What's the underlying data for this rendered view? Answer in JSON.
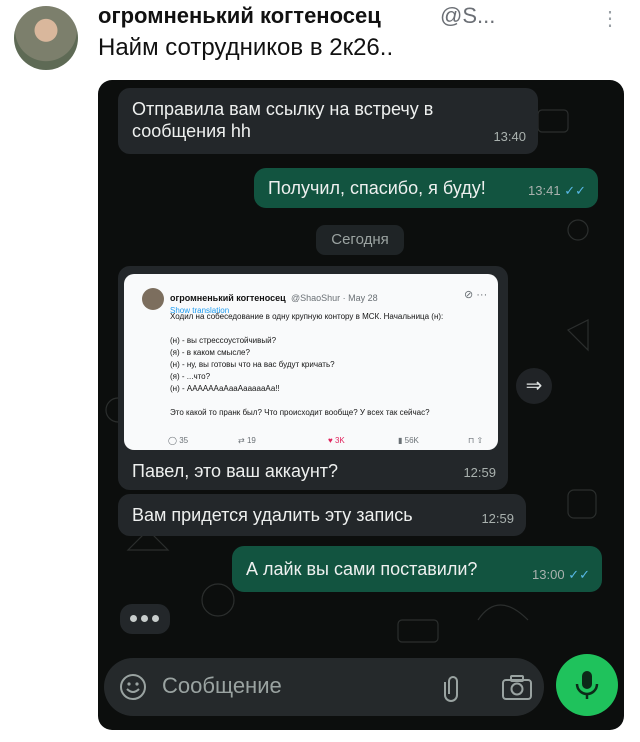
{
  "post": {
    "author_name": "огромненький когтеносец",
    "author_handle": "@S...",
    "text": "Найм сотрудников в 2к26.."
  },
  "chat": {
    "messages": [
      {
        "text": "Отправила вам ссылку на встречу в сообщения hh",
        "time": "13:40",
        "direction": "incoming"
      },
      {
        "text": "Получил, спасибо, я буду!",
        "time": "13:41",
        "direction": "outgoing",
        "read": true
      },
      {
        "text": "Павел, это ваш аккаунт?",
        "time": "12:59",
        "direction": "incoming"
      },
      {
        "text": "Вам придется удалить эту запись",
        "time": "12:59",
        "direction": "incoming"
      },
      {
        "text": "А лайк вы сами поставили?",
        "time": "13:00",
        "direction": "outgoing",
        "read": true
      }
    ],
    "date_separator": "Сегодня",
    "input_placeholder": "Сообщение",
    "read_receipt_icon": "double-check-icon",
    "colors": {
      "incoming": "#23272a",
      "outgoing": "#125440",
      "accent": "#1fc25c",
      "check": "#58b8e6"
    }
  },
  "screenshot": {
    "author_name": "огромненький когтеносец",
    "meta": "@ShaoShur · May 28",
    "translate_label": "Show translation",
    "lines": [
      "Ходил на собеседование в одну крупную контору в МСК. Начальница (н):",
      "",
      "(н) - вы стрессоустойчивый?",
      "(я) - в каком смысле?",
      "(н) - ну, вы готовы что на вас будут кричать?",
      "(я) - ...что?",
      "(н) - ААААААаАааАаааааАа!!",
      "",
      "Это какой то пранк был? Что происходит вообще? У всех так сейчас?"
    ],
    "stats": {
      "replies": "35",
      "reposts": "19",
      "likes": "3K",
      "views": "56K"
    }
  }
}
